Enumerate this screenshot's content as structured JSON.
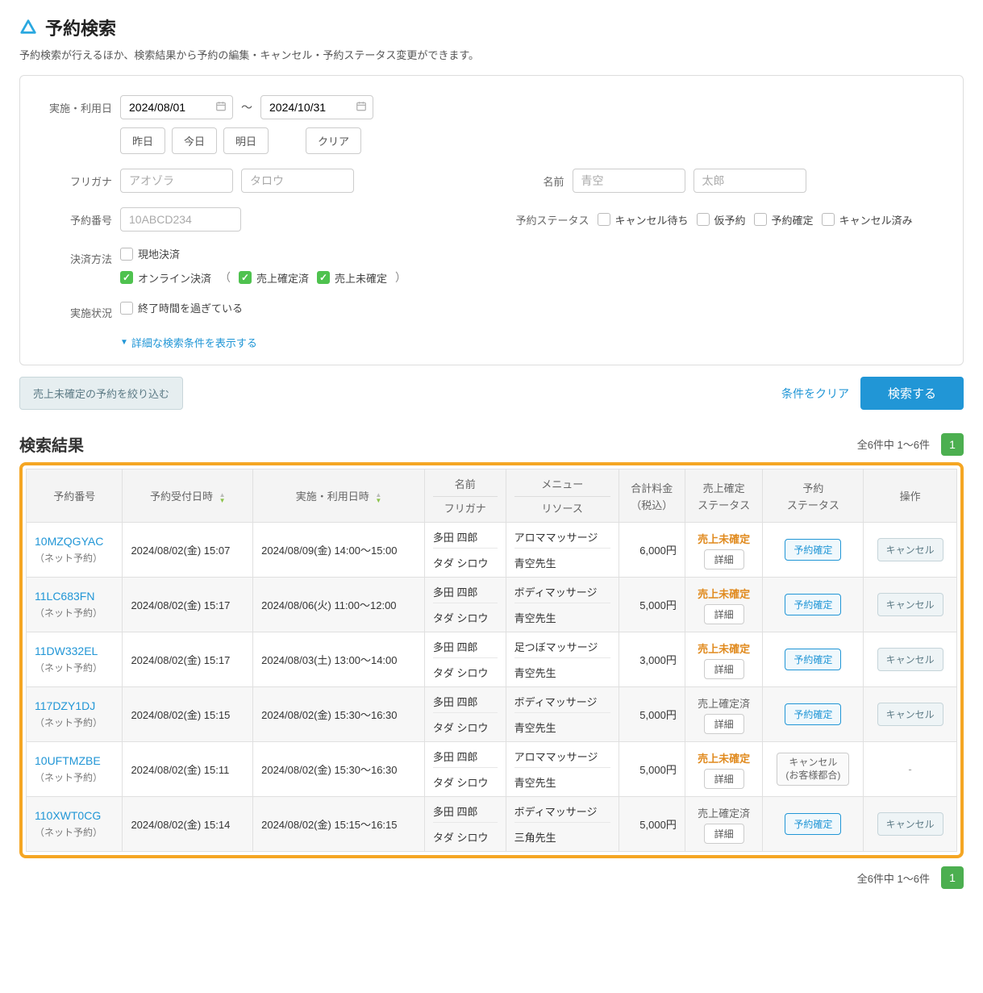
{
  "page": {
    "title": "予約検索",
    "subtitle": "予約検索が行えるほか、検索結果から予約の編集・キャンセル・予約ステータス変更ができます。"
  },
  "form": {
    "date_label": "実施・利用日",
    "date_from": "2024/08/01",
    "date_to": "2024/10/31",
    "date_sep": "〜",
    "btn_yesterday": "昨日",
    "btn_today": "今日",
    "btn_tomorrow": "明日",
    "btn_clear_date": "クリア",
    "furigana_label": "フリガナ",
    "furigana_last_ph": "アオゾラ",
    "furigana_first_ph": "タロウ",
    "name_label": "名前",
    "name_last_ph": "青空",
    "name_first_ph": "太郎",
    "reservation_no_label": "予約番号",
    "reservation_no_ph": "10ABCD234",
    "res_status_label": "予約ステータス",
    "cb_waitlist": "キャンセル待ち",
    "cb_tentative": "仮予約",
    "cb_confirmed": "予約確定",
    "cb_cancelled": "キャンセル済み",
    "payment_label": "決済方法",
    "cb_onsite": "現地決済",
    "cb_online": "オンライン決済",
    "cb_sales_fixed": "売上確定済",
    "cb_sales_unfixed": "売上未確定",
    "exec_label": "実施状況",
    "cb_past_end": "終了時間を過ぎている",
    "adv_toggle": "詳細な検索条件を表示する"
  },
  "actions": {
    "filter_unfixed": "売上未確定の予約を絞り込む",
    "clear_conditions": "条件をクリア",
    "search": "検索する"
  },
  "results": {
    "title": "検索結果",
    "count_text": "全6件中 1〜6件",
    "page_current": "1",
    "headers": {
      "res_no": "予約番号",
      "received": "予約受付日時",
      "usage": "実施・利用日時",
      "name": "名前",
      "furigana": "フリガナ",
      "menu": "メニュー",
      "resource": "リソース",
      "price": "合計料金",
      "price_sub": "（税込）",
      "sales_status": "売上確定",
      "sales_status_sub": "ステータス",
      "res_status": "予約",
      "res_status_sub": "ステータス",
      "ops": "操作"
    },
    "labels": {
      "detail": "詳細",
      "cancel": "キャンセル",
      "confirmed_btn": "予約確定",
      "status_unfixed": "売上未確定",
      "status_fixed": "売上確定済",
      "cancel_reason_top": "キャンセル",
      "cancel_reason_bottom": "(お客様都合)"
    },
    "rows": [
      {
        "id": "10MZQGYAC",
        "src": "（ネット予約）",
        "received": "2024/08/02(金) 15:07",
        "usage": "2024/08/09(金) 14:00〜15:00",
        "name": "多田 四郎",
        "furigana": "タダ シロウ",
        "menu": "アロママッサージ",
        "resource": "青空先生",
        "price": "6,000円",
        "sales_status": "unfixed",
        "res_status": "confirmed",
        "cancellable": true
      },
      {
        "id": "11LC683FN",
        "src": "（ネット予約）",
        "received": "2024/08/02(金) 15:17",
        "usage": "2024/08/06(火) 11:00〜12:00",
        "name": "多田 四郎",
        "furigana": "タダ シロウ",
        "menu": "ボディマッサージ",
        "resource": "青空先生",
        "price": "5,000円",
        "sales_status": "unfixed",
        "res_status": "confirmed",
        "cancellable": true
      },
      {
        "id": "11DW332EL",
        "src": "（ネット予約）",
        "received": "2024/08/02(金) 15:17",
        "usage": "2024/08/03(土) 13:00〜14:00",
        "name": "多田 四郎",
        "furigana": "タダ シロウ",
        "menu": "足つぼマッサージ",
        "resource": "青空先生",
        "price": "3,000円",
        "sales_status": "unfixed",
        "res_status": "confirmed",
        "cancellable": true
      },
      {
        "id": "117DZY1DJ",
        "src": "（ネット予約）",
        "received": "2024/08/02(金) 15:15",
        "usage": "2024/08/02(金) 15:30〜16:30",
        "name": "多田 四郎",
        "furigana": "タダ シロウ",
        "menu": "ボディマッサージ",
        "resource": "青空先生",
        "price": "5,000円",
        "sales_status": "fixed",
        "res_status": "confirmed",
        "cancellable": true
      },
      {
        "id": "10UFTMZBE",
        "src": "（ネット予約）",
        "received": "2024/08/02(金) 15:11",
        "usage": "2024/08/02(金) 15:30〜16:30",
        "name": "多田 四郎",
        "furigana": "タダ シロウ",
        "menu": "アロママッサージ",
        "resource": "青空先生",
        "price": "5,000円",
        "sales_status": "unfixed",
        "res_status": "cancelled",
        "cancellable": false
      },
      {
        "id": "110XWT0CG",
        "src": "（ネット予約）",
        "received": "2024/08/02(金) 15:14",
        "usage": "2024/08/02(金) 15:15〜16:15",
        "name": "多田 四郎",
        "furigana": "タダ シロウ",
        "menu": "ボディマッサージ",
        "resource": "三角先生",
        "price": "5,000円",
        "sales_status": "fixed",
        "res_status": "confirmed",
        "cancellable": true
      }
    ]
  }
}
